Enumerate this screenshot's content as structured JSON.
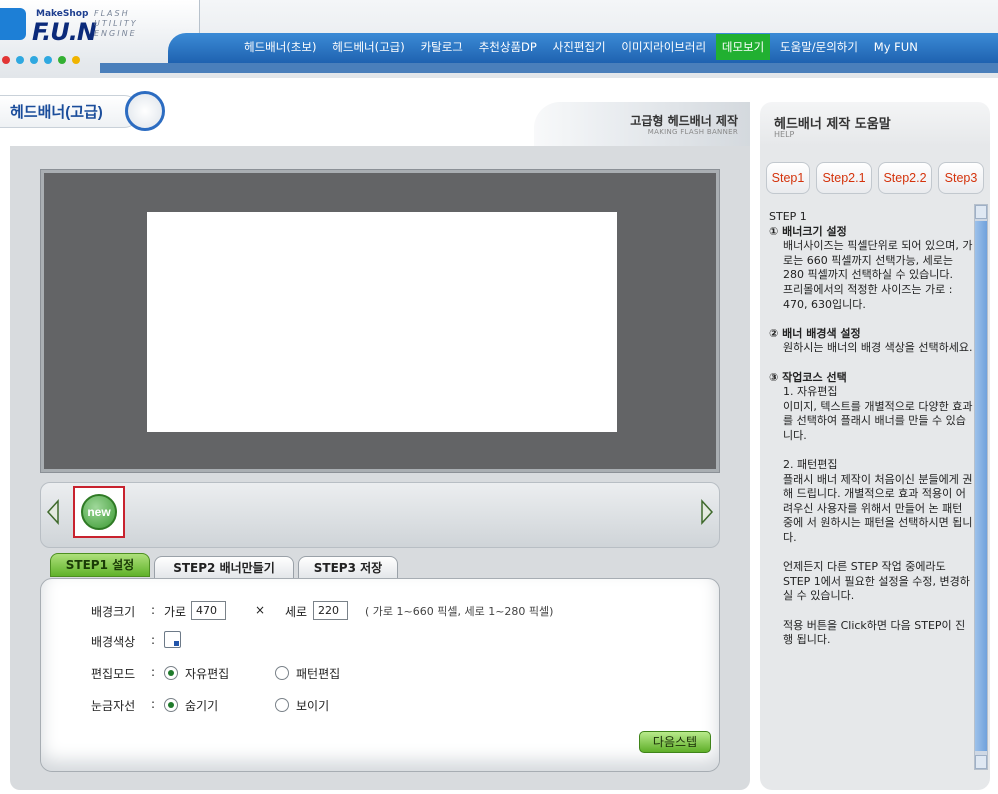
{
  "header": {
    "logo_make": "MakeShop",
    "logo_fun": "F.U.N",
    "logo_sub": "FLASH UTILITY ENGINE",
    "dot_colors": [
      "#e23535",
      "#2fa8e0",
      "#2fa8e0",
      "#2fa8e0",
      "#33b033",
      "#f0b400"
    ]
  },
  "nav": {
    "items": [
      {
        "label": "헤드배너(초보)"
      },
      {
        "label": "헤드베너(고급)"
      },
      {
        "label": "카탈로그"
      },
      {
        "label": "추천상품DP"
      },
      {
        "label": "사진편집기"
      },
      {
        "label": "이미지라이브러리"
      },
      {
        "label": "데모보기",
        "active": true
      },
      {
        "label": "도움말/문의하기"
      },
      {
        "label": "My FUN"
      }
    ]
  },
  "page": {
    "title": "헤드배너(고급)"
  },
  "main": {
    "title": "고급형 헤드배너 제작",
    "subtitle": "MAKING FLASH BANNER",
    "canvas": {
      "width": 470,
      "height": 220
    },
    "strip": {
      "new_label": "new"
    }
  },
  "tabs": [
    {
      "label": "STEP1 설정",
      "active": true
    },
    {
      "label": "STEP2 배너만들기"
    },
    {
      "label": "STEP3 저장"
    }
  ],
  "settings": {
    "size_label": "배경크기",
    "colon": ":",
    "width_label": "가로",
    "width_value": "470",
    "times": "×",
    "height_label": "세로",
    "height_value": "220",
    "range_hint": "( 가로 1~660 픽셀, 세로 1~280 픽셀)",
    "color_label": "배경색상",
    "mode_label": "편집모드",
    "mode_free": "자유편집",
    "mode_pattern": "패턴편집",
    "grid_label": "눈금자선",
    "grid_hide": "숨기기",
    "grid_show": "보이기",
    "next_button": "다음스텝"
  },
  "help": {
    "title": "헤드배너 제작 도움말",
    "subtitle": "HELP",
    "steps": [
      "Step1",
      "Step2.1",
      "Step2.2",
      "Step3"
    ],
    "lines": [
      {
        "t": "STEP 1",
        "c": ""
      },
      {
        "t": "① 배너크기 설정",
        "c": "h"
      },
      {
        "t": "배너사이즈는 픽셀단위로 되어 있으며, 가로는 660 픽셀까지 선택가능, 세로는 280 픽셀까지 선택하실 수 있습니다.",
        "c": "ind"
      },
      {
        "t": "프리몰에서의 적정한 사이즈는 가로 : 470, 630입니다.",
        "c": "ind"
      },
      {
        "t": "",
        "c": "gap"
      },
      {
        "t": "② 배너 배경색 설정",
        "c": "h"
      },
      {
        "t": "원하시는 배너의 배경 색상을 선택하세요.",
        "c": "ind"
      },
      {
        "t": "",
        "c": "gap"
      },
      {
        "t": "③ 작업코스 선택",
        "c": "h"
      },
      {
        "t": "1. 자유편집",
        "c": "ind"
      },
      {
        "t": "이미지, 텍스트를 개별적으로 다양한 효과를 선택하여 플래시 배너를 만들 수 있습니다.",
        "c": "ind"
      },
      {
        "t": "",
        "c": "gap"
      },
      {
        "t": "2. 패턴편집",
        "c": "ind"
      },
      {
        "t": "플래시 배너 제작이 처음이신 분들에게 권해 드립니다. 개별적으로 효과 적용이 어려우신 사용자를 위해서 만들어 논 패턴 중에 서 원하시는 패턴을 선택하시면 됩니다.",
        "c": "ind"
      },
      {
        "t": "",
        "c": "gap"
      },
      {
        "t": "언제든지 다른 STEP 작업 중에라도 STEP 1에서 필요한 설정을 수정, 변경하실 수 있습니다.",
        "c": "ind"
      },
      {
        "t": "",
        "c": "gap"
      },
      {
        "t": "적용 버튼을 Click하면 다음 STEP이 진행 됩니다.",
        "c": "ind"
      }
    ]
  }
}
